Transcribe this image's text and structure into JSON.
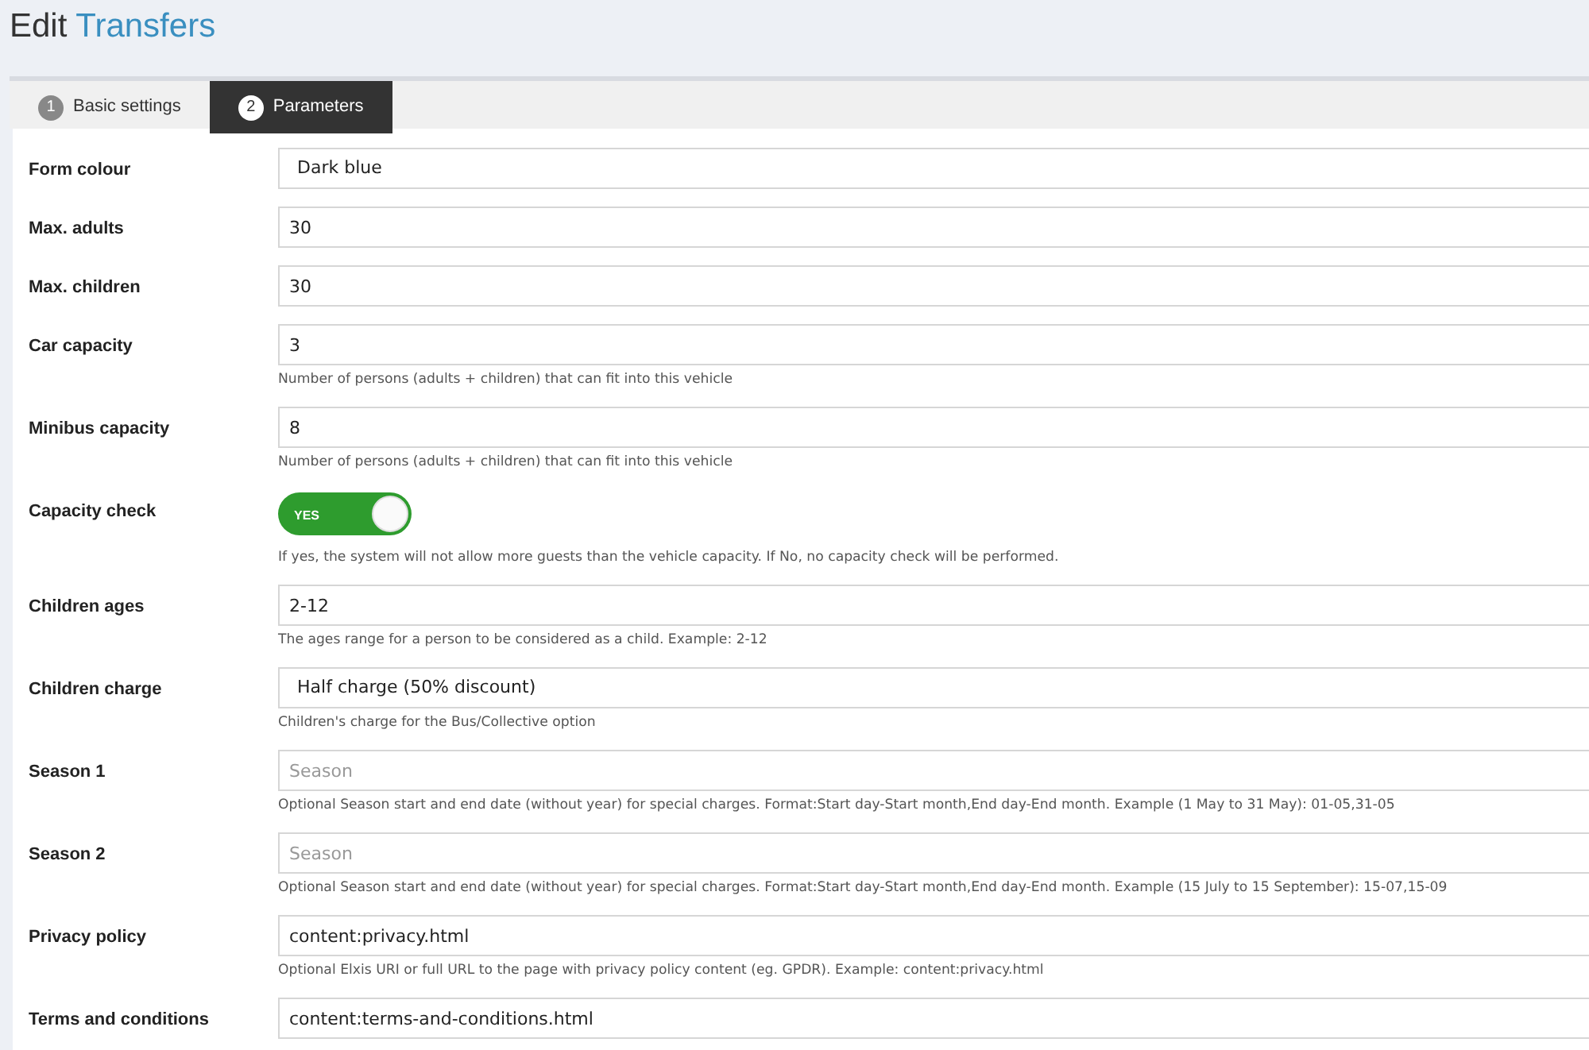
{
  "title": {
    "prefix": "Edit",
    "name": "Transfers"
  },
  "tabs": [
    {
      "number": "1",
      "label": "Basic settings",
      "selected": false
    },
    {
      "number": "2",
      "label": "Parameters",
      "selected": true
    }
  ],
  "fields": [
    {
      "kind": "select",
      "label": "Form colour",
      "value": "Dark blue"
    },
    {
      "kind": "text",
      "label": "Max. adults",
      "value": "30"
    },
    {
      "kind": "text",
      "label": "Max. children",
      "value": "30"
    },
    {
      "kind": "text",
      "label": "Car capacity",
      "value": "3",
      "help": "Number of persons (adults + children) that can fit into this vehicle"
    },
    {
      "kind": "text",
      "label": "Minibus capacity",
      "value": "8",
      "help": "Number of persons (adults + children) that can fit into this vehicle"
    },
    {
      "kind": "toggle",
      "label": "Capacity check",
      "on": true,
      "toggle_text": "YES",
      "help": "If yes, the system will not allow more guests than the vehicle capacity. If No, no capacity check will be performed."
    },
    {
      "kind": "text",
      "label": "Children ages",
      "value": "2-12",
      "help": "The ages range for a person to be considered as a child. Example: 2-12"
    },
    {
      "kind": "select",
      "label": "Children charge",
      "value": "Half charge (50% discount)",
      "help": "Children's charge for the Bus/Collective option"
    },
    {
      "kind": "text",
      "label": "Season 1",
      "placeholder": "Season",
      "help": "Optional Season start and end date (without year) for special charges. Format:Start day-Start month,End day-End month. Example (1 May to 31 May): 01-05,31-05"
    },
    {
      "kind": "text",
      "label": "Season 2",
      "placeholder": "Season",
      "help": "Optional Season start and end date (without year) for special charges. Format:Start day-Start month,End day-End month. Example (15 July to 15 September): 15-07,15-09"
    },
    {
      "kind": "text",
      "label": "Privacy policy",
      "value": "content:privacy.html",
      "help": "Optional Elxis URI or full URL to the page with privacy policy content (eg. GPDR). Example: content:privacy.html"
    },
    {
      "kind": "text",
      "label": "Terms and conditions",
      "value": "content:terms-and-conditions.html"
    }
  ]
}
